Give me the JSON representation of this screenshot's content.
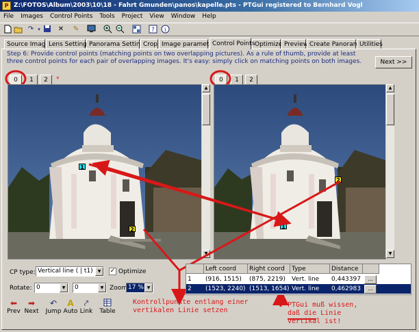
{
  "window": {
    "title": "Z:\\FOTOS\\Album\\2003\\10\\18 - Fahrt Gmunden\\panos\\kapelle.pts - PTGui registered to Bernhard Vogl"
  },
  "menu": [
    "File",
    "Images",
    "Control Points",
    "Tools",
    "Project",
    "View",
    "Window",
    "Help"
  ],
  "toolbar": [
    "new-icon",
    "open-icon",
    "redo-icon",
    "save-icon",
    "delete-icon",
    "wand-icon",
    "screen-icon",
    "zoom-in-icon",
    "zoom-out-icon",
    "panorama-editor-icon",
    "help-icon",
    "info-icon"
  ],
  "tabs": [
    "Source Images",
    "Lens Settings",
    "Panorama Settings",
    "Crop",
    "Image parameters",
    "Control Points",
    "Optimizer",
    "Preview",
    "Create Panorama",
    "Utilities"
  ],
  "active_tab": "Control Points",
  "instruction": "Step 6: Provide control points (matching points on two overlapping pictures). As a rule of thumb, provide at least three control points for each pair of overlapping images. It's easy: simply click on matching points on both images.",
  "next_button": "Next >>",
  "left_image_tabs": [
    "0",
    "1",
    "2",
    "*"
  ],
  "right_image_tabs": [
    "0",
    "1",
    "2"
  ],
  "markers": {
    "left": [
      "1",
      "2"
    ],
    "right": [
      "2",
      "1"
    ]
  },
  "controls": {
    "cp_type_label": "CP type:",
    "cp_type_value": "Vertical line    ( | t1)",
    "optimize_label": "Optimize",
    "optimize_checked": true,
    "rotate_label": "Rotate:",
    "rotate_left": "0",
    "rotate_right": "0",
    "zoom_label": "Zoom:",
    "zoom_value": "17 %"
  },
  "cp_table": {
    "headers": [
      "",
      "Left coord",
      "Right coord",
      "Type",
      "Distance",
      ""
    ],
    "rows": [
      {
        "id": "1",
        "left": "(916, 1515)",
        "right": "(875, 2219)",
        "type": "Vert. line",
        "distance": "0,443397",
        "action": "...",
        "selected": false
      },
      {
        "id": "2",
        "left": "(1523, 2240)",
        "right": "(1513, 1654)",
        "type": "Vert. line",
        "distance": "0,462983",
        "action": "...",
        "selected": true
      }
    ]
  },
  "bottom_buttons": [
    {
      "label": "Prev",
      "icon": "arrow-left-icon"
    },
    {
      "label": "Next",
      "icon": "arrow-right-icon"
    },
    {
      "label": "Jump",
      "icon": "jump-icon"
    },
    {
      "label": "Auto",
      "icon": "auto-icon"
    },
    {
      "label": "Link",
      "icon": "link-icon"
    },
    {
      "label": "Table",
      "icon": "table-icon"
    }
  ],
  "annotations": {
    "left": "Kontrollpunkte entlang einer\nvertikalen Linie setzen",
    "right": "PTGui muß wissen,\ndaß die Linie\nvertikal ist!"
  },
  "colors": {
    "annotation": "#d81818",
    "selection": "#0a246a",
    "instruction": "#1a2a80"
  }
}
